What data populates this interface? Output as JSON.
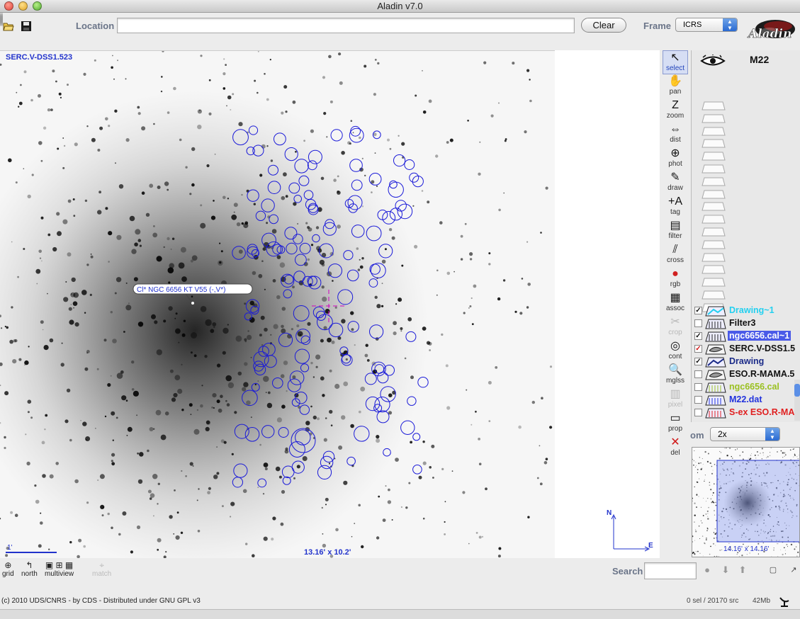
{
  "window": {
    "title": "Aladin v7.0"
  },
  "toolbar": {
    "location_label": "Location",
    "location_value": "",
    "clear_label": "Clear",
    "frame_label": "Frame",
    "frame_value": "ICRS"
  },
  "view": {
    "survey_label": "SERC.V-DSS1.523",
    "object_tag": "Cl* NGC 6656     KT V55 (-,V*)",
    "scale_label": "1'",
    "fov_label": "13.16' x 10.2'",
    "compass_n": "N",
    "compass_e": "E",
    "colors": {
      "overlay": "#1a1ad8",
      "marker": "#d000c0",
      "background": "#f6f6f6"
    }
  },
  "tools": [
    {
      "name": "select",
      "icon": "arrow-icon",
      "glyph": "↖",
      "active": true,
      "enabled": true
    },
    {
      "name": "pan",
      "icon": "hand-icon",
      "glyph": "✋",
      "active": false,
      "enabled": true
    },
    {
      "name": "zoom",
      "icon": "zoom-icon",
      "glyph": "Z",
      "active": false,
      "enabled": true
    },
    {
      "name": "dist",
      "icon": "ruler-icon",
      "glyph": "⇔",
      "active": false,
      "enabled": true
    },
    {
      "name": "phot",
      "icon": "target-icon",
      "glyph": "⊕",
      "active": false,
      "enabled": true
    },
    {
      "name": "draw",
      "icon": "pencil-icon",
      "glyph": "✎",
      "active": false,
      "enabled": true
    },
    {
      "name": "tag",
      "icon": "tag-icon",
      "glyph": "+A",
      "active": false,
      "enabled": true
    },
    {
      "name": "filter",
      "icon": "filter-icon",
      "glyph": "▤",
      "active": false,
      "enabled": true
    },
    {
      "name": "cross",
      "icon": "crossmatch-icon",
      "glyph": "⫽",
      "active": false,
      "enabled": true
    },
    {
      "name": "rgb",
      "icon": "rgb-icon",
      "glyph": "●",
      "active": false,
      "enabled": true
    },
    {
      "name": "assoc",
      "icon": "assoc-icon",
      "glyph": "▦",
      "active": false,
      "enabled": true
    },
    {
      "name": "crop",
      "icon": "scissors-icon",
      "glyph": "✂",
      "active": false,
      "enabled": false
    },
    {
      "name": "cont",
      "icon": "contour-icon",
      "glyph": "◎",
      "active": false,
      "enabled": true
    },
    {
      "name": "mglss",
      "icon": "magnifier-icon",
      "glyph": "🔍",
      "active": false,
      "enabled": true
    },
    {
      "name": "pixel",
      "icon": "pixel-icon",
      "glyph": "▥",
      "active": false,
      "enabled": false
    },
    {
      "name": "prop",
      "icon": "properties-icon",
      "glyph": "▭",
      "active": false,
      "enabled": true
    },
    {
      "name": "del",
      "icon": "delete-icon",
      "glyph": "✕",
      "active": false,
      "enabled": true
    }
  ],
  "stack": {
    "title": "M22",
    "layers": [
      {
        "name": "Drawing~1",
        "checked": true,
        "color": "#22d0f0",
        "icon": "drawing-layer-icon",
        "selected": false
      },
      {
        "name": "Filter3",
        "checked": false,
        "color": "#111111",
        "icon": "filter-layer-icon",
        "selected": false
      },
      {
        "name": "ngc6656.cal~1",
        "checked": true,
        "color": "#ffffff",
        "icon": "catalog-layer-icon",
        "selected": true
      },
      {
        "name": "SERC.V-DSS1.5",
        "checked": true,
        "color": "#111111",
        "icon": "image-layer-icon",
        "selected": false
      },
      {
        "name": "Drawing",
        "checked": true,
        "color": "#1a2a88",
        "icon": "drawing-layer-icon",
        "selected": false
      },
      {
        "name": "ESO.R-MAMA.5",
        "checked": false,
        "color": "#111111",
        "icon": "image-layer-icon",
        "selected": false
      },
      {
        "name": "ngc6656.cal",
        "checked": false,
        "color": "#9ac020",
        "icon": "catalog-layer-icon",
        "selected": false
      },
      {
        "name": "M22.dat",
        "checked": false,
        "color": "#2233dd",
        "icon": "catalog-layer-icon",
        "selected": false
      },
      {
        "name": "S-ex ESO.R-MAMA",
        "checked": false,
        "color": "#e02020",
        "icon": "catalog-layer-icon",
        "selected": false
      }
    ]
  },
  "zoom": {
    "label": "om",
    "value": "2x"
  },
  "preview": {
    "label": "14.16' x 14.16'"
  },
  "bottom_tools": [
    {
      "label": "grid",
      "icon": "grid-icon",
      "glyph": "⊕"
    },
    {
      "label": "north",
      "icon": "north-icon",
      "glyph": "↰"
    },
    {
      "label": "multiview",
      "icon": "multiview-icon",
      "glyph": "▣ ⊞ ▦"
    },
    {
      "label": "match",
      "icon": "match-icon",
      "glyph": "⌖"
    }
  ],
  "search": {
    "label": "Search",
    "value": ""
  },
  "status": {
    "copyright": "(c) 2010 UDS/CNRS - by CDS - Distributed under GNU GPL v3",
    "selection": "0 sel / 20170 src",
    "memory": "42Mb"
  }
}
